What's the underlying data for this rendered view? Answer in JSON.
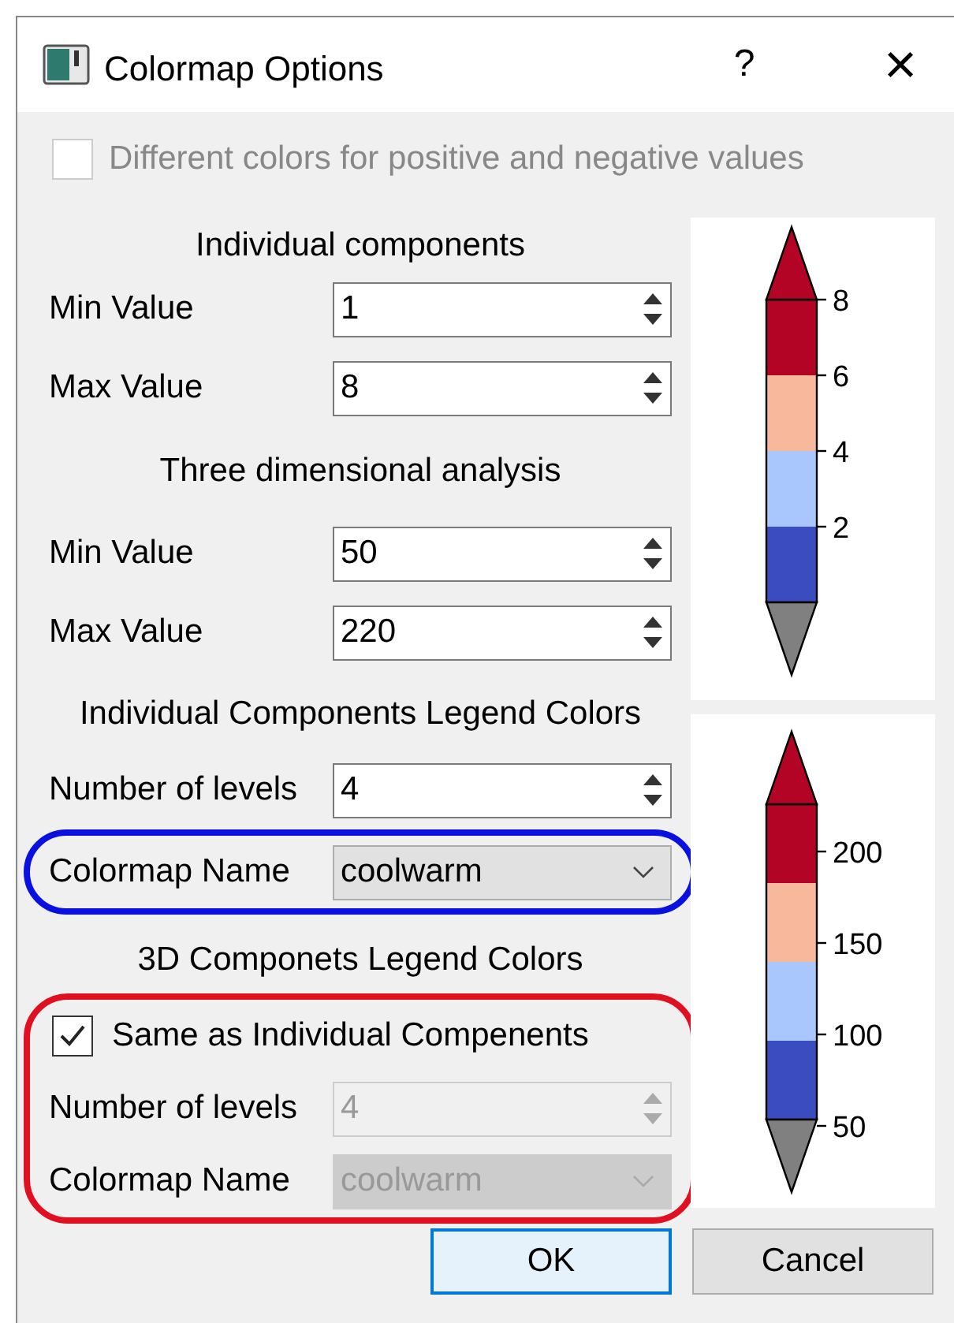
{
  "window": {
    "title": "Colormap Options",
    "help": "?",
    "close": "×"
  },
  "sign_checkbox": {
    "label": "Different colors for positive and negative values",
    "checked": false,
    "disabled": true
  },
  "sections": [
    {
      "heading": "Individual components",
      "blocks": [
        {
          "rows": [
            {
              "kind": "spin",
              "label": "Min Value",
              "value": "1",
              "disabled": false
            },
            {
              "kind": "spin",
              "label": "Max Value",
              "value": "8",
              "disabled": false
            }
          ]
        }
      ]
    },
    {
      "heading": "Three dimensional analysis",
      "blocks": [
        {
          "rows": [
            {
              "kind": "spin",
              "label": "Min Value",
              "value": "50",
              "disabled": false
            },
            {
              "kind": "spin",
              "label": "Max Value",
              "value": "220",
              "disabled": false
            }
          ]
        }
      ]
    },
    {
      "heading": "Individual Components Legend Colors",
      "blocks": [
        {
          "rows": [
            {
              "kind": "spin",
              "label": "Number of levels",
              "value": "4",
              "disabled": false
            }
          ]
        },
        {
          "color": "#0a10e0",
          "rows": [
            {
              "kind": "combo",
              "label": "Colormap Name",
              "value": "coolwarm",
              "disabled": false
            }
          ]
        }
      ]
    },
    {
      "heading": "3D Componets Legend Colors",
      "blocks": [
        {
          "color": "#e01020",
          "rows": [
            {
              "kind": "check",
              "label": "Same as Individual Compenents",
              "checked": true
            },
            {
              "kind": "spin",
              "label": "Number of levels",
              "value": "4",
              "disabled": true
            },
            {
              "kind": "combo",
              "label": "Colormap Name",
              "value": "coolwarm",
              "disabled": true
            }
          ]
        }
      ]
    }
  ],
  "colorbars": [
    {
      "segments": [
        {
          "kind": "over",
          "color": "#b40426"
        },
        {
          "kind": "band",
          "color": "#b40426",
          "tick": "8"
        },
        {
          "kind": "band",
          "color": "#f7b89c",
          "tick": "6"
        },
        {
          "kind": "band",
          "color": "#aac7fd",
          "tick": "4"
        },
        {
          "kind": "band",
          "color": "#3b4cc0",
          "tick": "2"
        },
        {
          "kind": "under",
          "color": "#808080"
        }
      ]
    },
    {
      "segments": [
        {
          "kind": "over",
          "color": "#b40426"
        },
        {
          "kind": "band",
          "color": "#b40426",
          "tick": "200"
        },
        {
          "kind": "band",
          "color": "#f7b89c",
          "tick": "150"
        },
        {
          "kind": "band",
          "color": "#aac7fd",
          "tick": "100"
        },
        {
          "kind": "band",
          "color": "#3b4cc0",
          "tick": "50"
        },
        {
          "kind": "under",
          "color": "#808080"
        }
      ]
    }
  ],
  "buttons": [
    {
      "label": "OK",
      "default": true
    },
    {
      "label": "Cancel",
      "default": false
    }
  ]
}
